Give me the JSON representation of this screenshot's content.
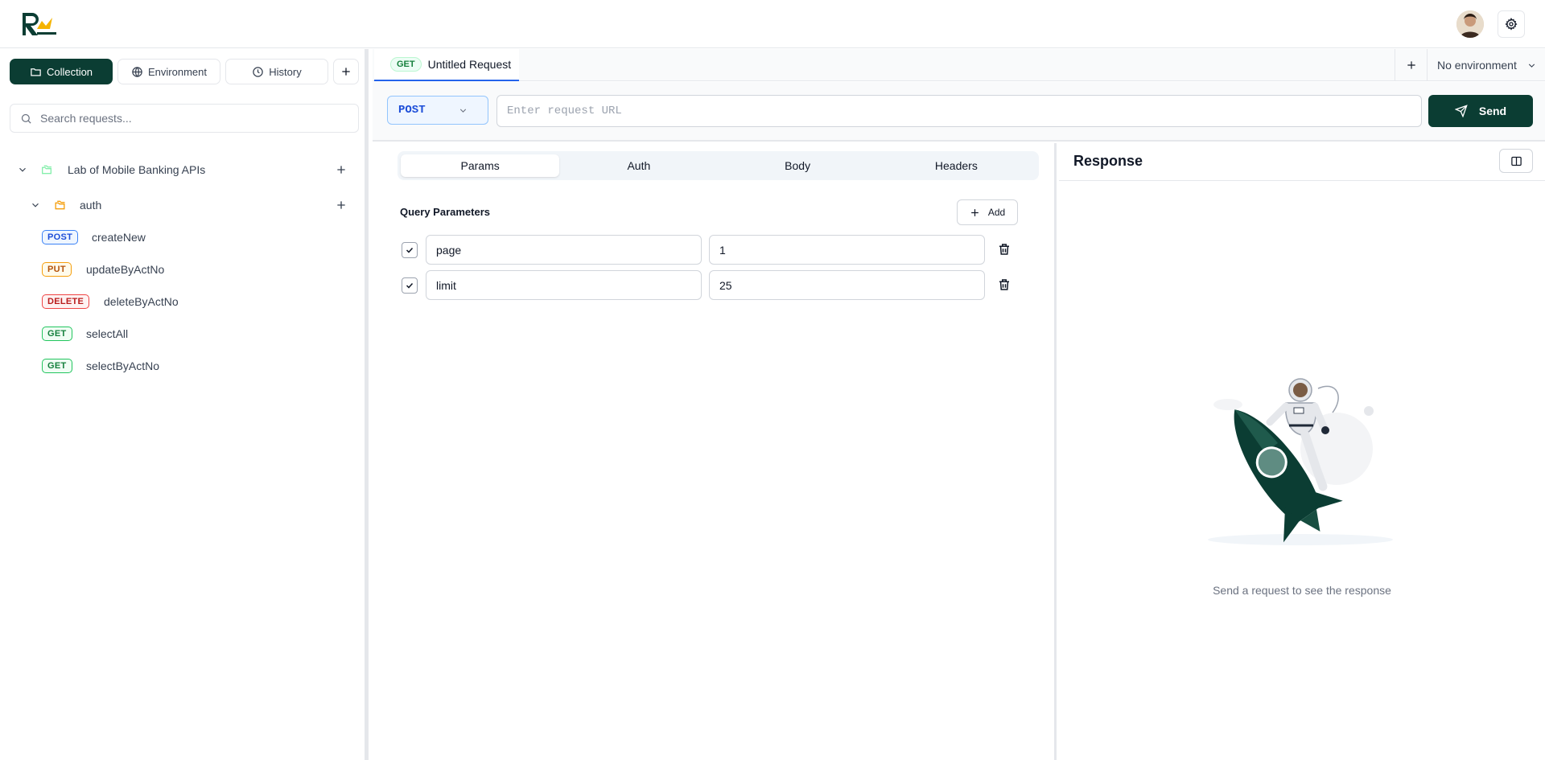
{
  "sidebar": {
    "tabs": [
      {
        "label": "Collection",
        "icon": "folder-icon"
      },
      {
        "label": "Environment",
        "icon": "globe-icon"
      },
      {
        "label": "History",
        "icon": "clock-icon"
      }
    ],
    "search_placeholder": "Search requests...",
    "collection": {
      "name": "Lab of Mobile Banking APIs",
      "folder": {
        "name": "auth",
        "requests": [
          {
            "method": "POST",
            "name": "createNew"
          },
          {
            "method": "PUT",
            "name": "updateByActNo"
          },
          {
            "method": "DELETE",
            "name": "deleteByActNo"
          },
          {
            "method": "GET",
            "name": "selectAll"
          },
          {
            "method": "GET",
            "name": "selectByActNo"
          }
        ]
      }
    }
  },
  "tabbar": {
    "active_tab": {
      "method": "GET",
      "title": "Untitled Request"
    },
    "environment": "No environment"
  },
  "request": {
    "method": "POST",
    "url_placeholder": "Enter request URL",
    "send_label": "Send",
    "tabs": [
      "Params",
      "Auth",
      "Body",
      "Headers"
    ],
    "active_tab": "Params",
    "query_title": "Query Parameters",
    "add_label": "Add",
    "params": [
      {
        "key": "page",
        "value": "1",
        "enabled": true
      },
      {
        "key": "limit",
        "value": "25",
        "enabled": true
      }
    ]
  },
  "response": {
    "title": "Response",
    "empty_message": "Send a request to see the response"
  },
  "colors": {
    "brand": "#0b3d33",
    "accent": "#2563eb",
    "post": "#1d4ed8",
    "put": "#b45309",
    "delete": "#b91c1c",
    "get": "#15803d"
  }
}
